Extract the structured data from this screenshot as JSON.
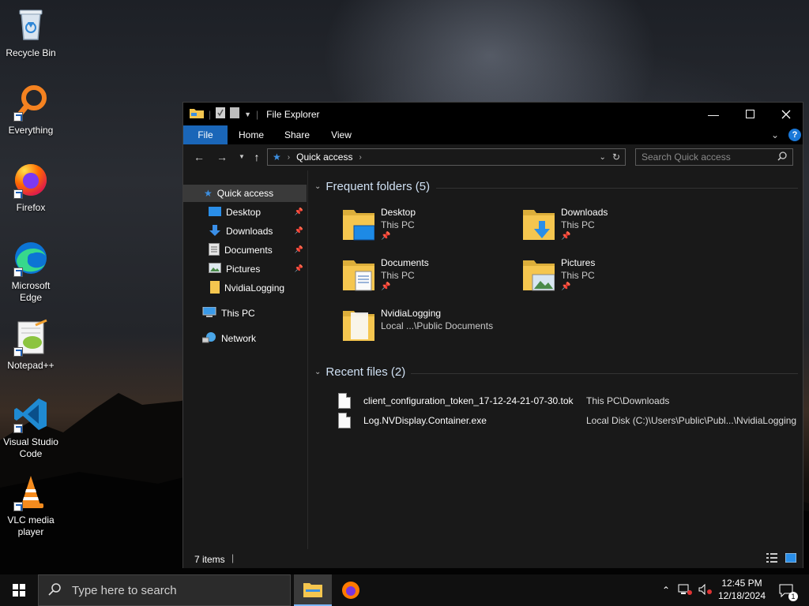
{
  "desktop": {
    "icons": [
      {
        "label": "Recycle Bin",
        "icon": "recycle-bin-icon"
      },
      {
        "label": "Everything",
        "icon": "everything-search-icon"
      },
      {
        "label": "Firefox",
        "icon": "firefox-icon"
      },
      {
        "label": "Microsoft Edge",
        "icon": "edge-icon"
      },
      {
        "label": "Notepad++",
        "icon": "notepad-plus-plus-icon"
      },
      {
        "label": "Visual Studio Code",
        "icon": "vscode-icon"
      },
      {
        "label": "VLC media player",
        "icon": "vlc-icon"
      }
    ]
  },
  "explorer": {
    "title": "File Explorer",
    "tabs": [
      "File",
      "Home",
      "Share",
      "View"
    ],
    "address": {
      "location": "Quick access"
    },
    "search": {
      "placeholder": "Search Quick access"
    },
    "sidebar": {
      "quick_access": "Quick access",
      "pinned": [
        {
          "label": "Desktop",
          "icon": "desktop-folder-icon",
          "pinned": true
        },
        {
          "label": "Downloads",
          "icon": "downloads-arrow-icon",
          "pinned": true
        },
        {
          "label": "Documents",
          "icon": "documents-icon",
          "pinned": true
        },
        {
          "label": "Pictures",
          "icon": "pictures-icon",
          "pinned": true
        },
        {
          "label": "NvidiaLogging",
          "icon": "folder-icon",
          "pinned": false
        }
      ],
      "this_pc": "This PC",
      "network": "Network"
    },
    "frequent": {
      "header": "Frequent folders (5)",
      "folders": [
        {
          "name": "Desktop",
          "location": "This PC",
          "pinned": true
        },
        {
          "name": "Downloads",
          "location": "This PC",
          "pinned": true
        },
        {
          "name": "Documents",
          "location": "This PC",
          "pinned": true
        },
        {
          "name": "Pictures",
          "location": "This PC",
          "pinned": true
        },
        {
          "name": "NvidiaLogging",
          "location": "Local ...\\Public Documents",
          "pinned": false
        }
      ]
    },
    "recent": {
      "header": "Recent files (2)",
      "files": [
        {
          "name": "client_configuration_token_17-12-24-21-07-30.tok",
          "location": "This PC\\Downloads"
        },
        {
          "name": "Log.NVDisplay.Container.exe",
          "location": "Local Disk (C:)\\Users\\Public\\Publ...\\NvidiaLogging"
        }
      ]
    },
    "status": {
      "items": "7 items"
    }
  },
  "taskbar": {
    "search_placeholder": "Type here to search",
    "time": "12:45 PM",
    "date": "12/18/2024",
    "notification_count": "1"
  },
  "colors": {
    "accent": "#1a66b8",
    "window_bg": "#191919",
    "folder_yellow": "#f5c64f"
  }
}
